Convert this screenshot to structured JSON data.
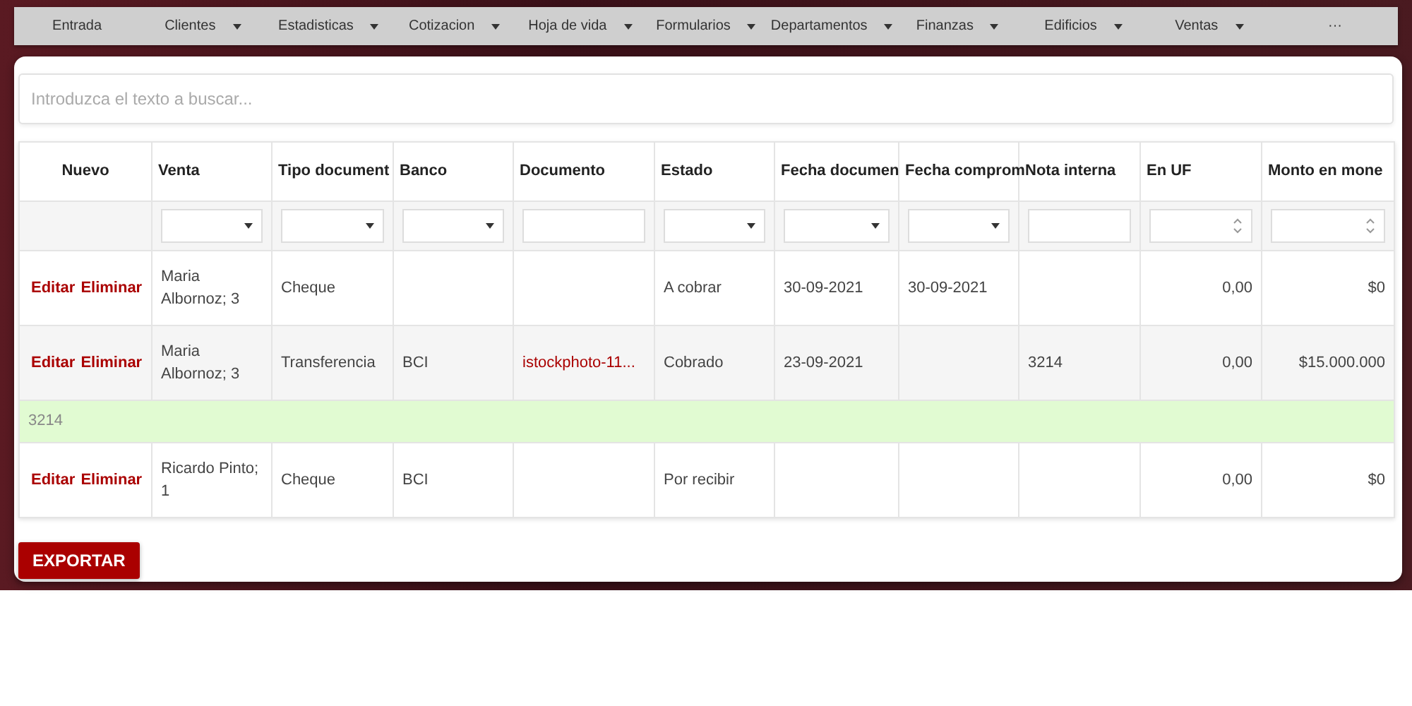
{
  "menu": [
    {
      "label": "Entrada",
      "dropdown": false
    },
    {
      "label": "Clientes",
      "dropdown": true
    },
    {
      "label": "Estadisticas",
      "dropdown": true
    },
    {
      "label": "Cotizacion",
      "dropdown": true
    },
    {
      "label": "Hoja de vida",
      "dropdown": true
    },
    {
      "label": "Formularios",
      "dropdown": true
    },
    {
      "label": "Departamentos",
      "dropdown": true
    },
    {
      "label": "Finanzas",
      "dropdown": true
    },
    {
      "label": "Edificios",
      "dropdown": true
    },
    {
      "label": "Ventas",
      "dropdown": true
    },
    {
      "label": "···",
      "dropdown": false
    }
  ],
  "search": {
    "placeholder": "Introduzca el texto a buscar..."
  },
  "table": {
    "new_label": "Nuevo",
    "columns": [
      {
        "label": "Venta",
        "kind": "select"
      },
      {
        "label": "Tipo document",
        "kind": "select"
      },
      {
        "label": "Banco",
        "kind": "select"
      },
      {
        "label": "Documento",
        "kind": "text"
      },
      {
        "label": "Estado",
        "kind": "select"
      },
      {
        "label": "Fecha documen",
        "kind": "select"
      },
      {
        "label": "Fecha comprom",
        "kind": "select"
      },
      {
        "label": "Nota interna",
        "kind": "text"
      },
      {
        "label": "En UF",
        "kind": "number"
      },
      {
        "label": "Monto en mone",
        "kind": "number"
      }
    ],
    "rows": [
      {
        "kind": "data",
        "actions": [
          "Editar",
          "Eliminar"
        ],
        "cells": [
          "Maria Albornoz; 3",
          "Cheque",
          "",
          "",
          "A cobrar",
          "30-09-2021",
          "30-09-2021",
          "",
          "0,00",
          "$0"
        ]
      },
      {
        "kind": "data",
        "actions": [
          "Editar",
          "Eliminar"
        ],
        "cells": [
          "Maria Albornoz; 3",
          "Transferencia",
          "BCI",
          {
            "kind": "link",
            "text": "istockphoto-11..."
          },
          "Cobrado",
          "23-09-2021",
          "",
          "3214",
          "0,00",
          "$15.000.000"
        ]
      },
      {
        "kind": "detail",
        "text": "3214"
      },
      {
        "kind": "data",
        "actions": [
          "Editar",
          "Eliminar"
        ],
        "cells": [
          "Ricardo Pinto; 1",
          "Cheque",
          "BCI",
          "",
          "Por recibir",
          "",
          "",
          "",
          "0,00",
          "$0"
        ]
      }
    ]
  },
  "export_button": "EXPORTAR"
}
